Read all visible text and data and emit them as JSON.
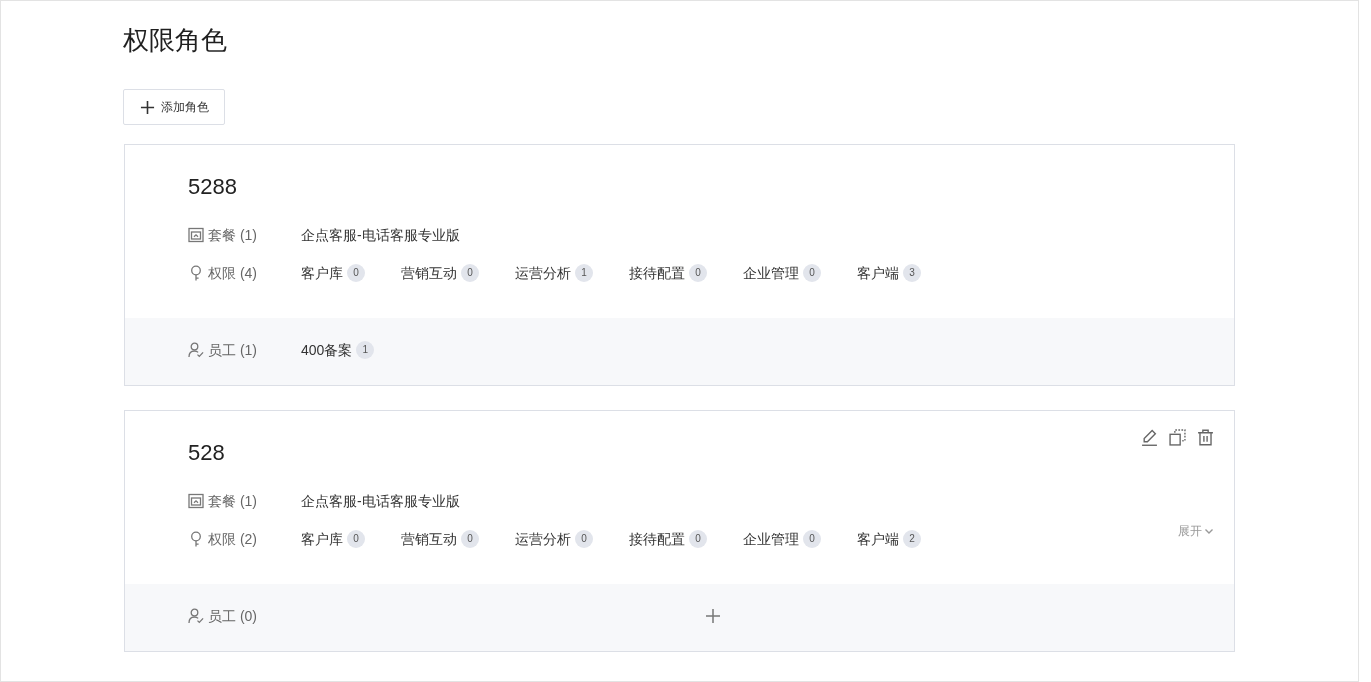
{
  "page": {
    "title": "权限角色"
  },
  "add_button": {
    "label": "添加角色"
  },
  "roles": [
    {
      "name": "5288",
      "hovered": false,
      "package": {
        "label": "套餐 (1)",
        "value": "企点客服-电话客服专业版"
      },
      "permissions": {
        "label": "权限 (4)",
        "items": [
          {
            "name": "客户库",
            "count": "0"
          },
          {
            "name": "营销互动",
            "count": "0"
          },
          {
            "name": "运营分析",
            "count": "1"
          },
          {
            "name": "接待配置",
            "count": "0"
          },
          {
            "name": "企业管理",
            "count": "0"
          },
          {
            "name": "客户端",
            "count": "3"
          }
        ]
      },
      "staff": {
        "label": "员工 (1)",
        "items": [
          {
            "name": "400备案",
            "count": "1"
          }
        ]
      }
    },
    {
      "name": "528",
      "hovered": true,
      "package": {
        "label": "套餐 (1)",
        "value": "企点客服-电话客服专业版"
      },
      "permissions": {
        "label": "权限 (2)",
        "items": [
          {
            "name": "客户库",
            "count": "0"
          },
          {
            "name": "营销互动",
            "count": "0"
          },
          {
            "name": "运营分析",
            "count": "0"
          },
          {
            "name": "接待配置",
            "count": "0"
          },
          {
            "name": "企业管理",
            "count": "0"
          },
          {
            "name": "客户端",
            "count": "2"
          }
        ],
        "expand_link": "展开"
      },
      "staff": {
        "label": "员工 (0)"
      }
    }
  ]
}
